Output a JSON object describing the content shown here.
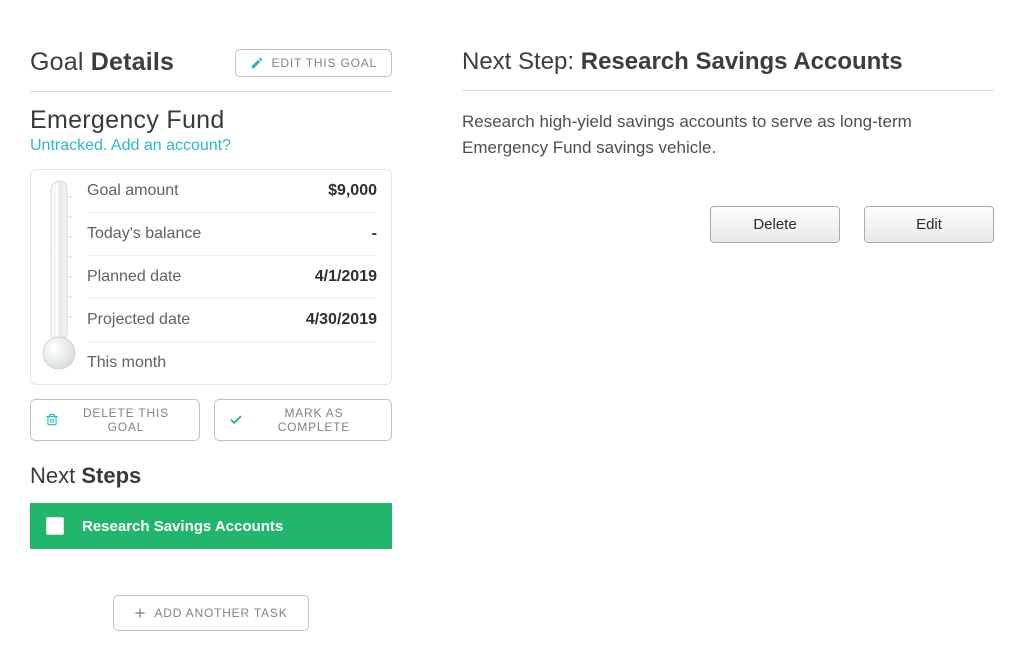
{
  "left": {
    "title_prefix": "Goal ",
    "title_bold": "Details",
    "edit_goal_label": "EDIT THIS GOAL",
    "goal_name": "Emergency Fund",
    "untracked_text": "Untracked. Add an account?",
    "summary": {
      "goal_amount_label": "Goal amount",
      "goal_amount_value": "$9,000",
      "today_balance_label": "Today's balance",
      "today_balance_value": "-",
      "planned_date_label": "Planned date",
      "planned_date_value": "4/1/2019",
      "projected_date_label": "Projected date",
      "projected_date_value": "4/30/2019",
      "this_month_label": "This month",
      "this_month_value": ""
    },
    "delete_goal_label": "DELETE THIS GOAL",
    "mark_complete_label": "MARK AS COMPLETE",
    "next_steps_prefix": "Next ",
    "next_steps_bold": "Steps",
    "tasks": [
      {
        "label": "Research Savings Accounts"
      }
    ],
    "add_task_label": "ADD ANOTHER TASK"
  },
  "right": {
    "title_prefix": "Next Step: ",
    "title_bold": "Research Savings Accounts",
    "description": "Research high-yield savings accounts to serve as long-term Emergency Fund savings vehicle.",
    "delete_label": "Delete",
    "edit_label": "Edit"
  },
  "colors": {
    "accent_green": "#21b66b",
    "accent_teal": "#2bb8c4"
  }
}
